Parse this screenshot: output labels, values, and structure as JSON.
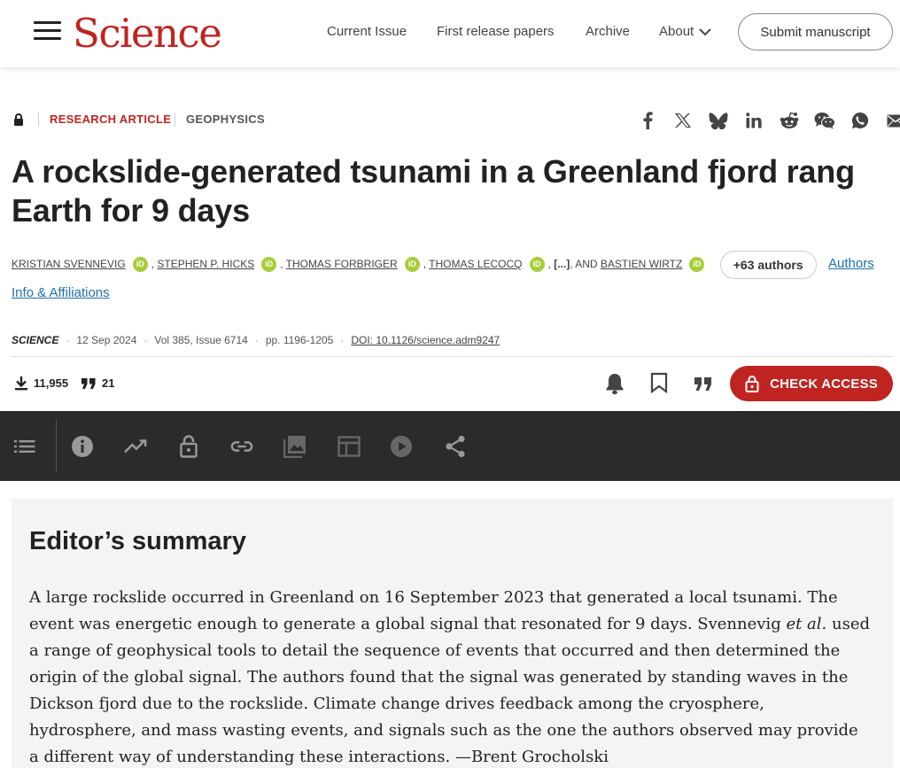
{
  "header": {
    "logo_text": "Science",
    "nav": [
      "Current Issue",
      "First release papers",
      "Archive",
      "About"
    ],
    "submit_label": "Submit manuscript"
  },
  "article": {
    "access_icon": "lock-icon",
    "article_type": "RESEARCH ARTICLE",
    "subject": "GEOPHYSICS",
    "title": "A rockslide-generated tsunami in a Greenland fjord rang Earth for 9 days",
    "authors": [
      "KRISTIAN SVENNEVIG",
      "STEPHEN P. HICKS",
      "THOMAS FORBRIGER",
      "THOMAS LECOCQ",
      "BASTIEN WIRTZ"
    ],
    "orcid_label": "iD",
    "authors_sep": ",",
    "ellipsis": "[...]",
    "and_label": ", AND",
    "more_authors": "+63 authors",
    "authors_info": "Authors Info & Affiliations",
    "journal": "SCIENCE",
    "date": "12 Sep 2024",
    "volume": "Vol 385, Issue 6714",
    "pages": "pp. 1196-1205",
    "doi": "DOI: 10.1126/science.adm9247",
    "downloads": "11,955",
    "citations": "21",
    "check_access": "CHECK ACCESS"
  },
  "share_icons": [
    "facebook-icon",
    "x-icon",
    "bluesky-icon",
    "linkedin-icon",
    "reddit-icon",
    "wechat-icon",
    "whatsapp-icon",
    "email-icon"
  ],
  "toolbar_icons": [
    "list-icon",
    "info-icon",
    "trending-icon",
    "unlock-icon",
    "link-icon",
    "image-icon",
    "table-icon",
    "play-icon",
    "share-icon"
  ],
  "summary": {
    "heading": "Editor’s summary",
    "text_before": "A large rockslide occurred in Greenland on 16 September 2023 that generated a local tsunami. The event was energetic enough to generate a global signal that resonated for 9 days. Svennevig ",
    "text_italic": "et al",
    "text_after": ". used a range of geophysical tools to detail the sequence of events that occurred and then determined the origin of the global signal. The authors found that the signal was generated by standing waves in the Dickson fjord due to the rockslide. Climate change drives feedback among the cryosphere, hydrosphere, and mass wasting events, and signals such as the one the authors observed may provide a different way of understanding these interactions. —Brent Grocholski"
  },
  "colors": {
    "brand_red": "#c02420",
    "link_blue": "#1f6fb0",
    "orcid_green": "#a6ce39",
    "toolbar_bg": "#2b2b2b",
    "summary_bg": "#f4f4f4"
  }
}
